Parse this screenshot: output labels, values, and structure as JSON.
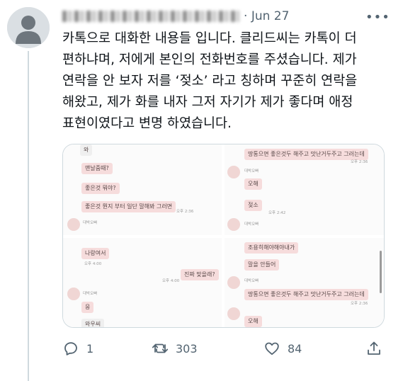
{
  "tweet": {
    "author_name": "",
    "time": "Jun 27",
    "more_label": "•••",
    "text": "카톡으로 대화한 내용들 입니다. 클리드씨는 카톡이 더\n편하냐며, 저에게 본인의 전화번호를 주셨습니다. 제가\n연락을 안 보자 저를 ‘젖소’ 라고 칭하며 꾸준히 연락을\n해왔고, 제가 화를 내자 그저 자기가 제가 좋다며 애정\n표현이였다고 변명 하였습니다."
  },
  "media": {
    "tiles": [
      {
        "messages": [
          {
            "text": "와"
          },
          {
            "text": "맨날줌때?"
          },
          {
            "text": "좋은것 뭐야?"
          },
          {
            "text": "좋은것 뭔지 부터 일단 말해봐 그러면"
          }
        ],
        "sender": "대박오빠",
        "time": "오후 2:36"
      },
      {
        "messages": [
          {
            "text": "땅통으면 좋은것두 해주고 맛난거두주고 그러는데"
          },
          {
            "text": "오해"
          },
          {
            "text": "젖소"
          }
        ],
        "sender": "대박오빠",
        "time_a": "오후 2:36",
        "time_b": "오후 2:42"
      },
      {
        "messages": [
          {
            "text": "나랑여서"
          },
          {
            "text": "진짜 맞을래?"
          },
          {
            "text": "응"
          },
          {
            "text": "와우씨"
          }
        ],
        "sender": "대박오빠",
        "time_a": "오후 4:00",
        "time_b": "오후 4:00"
      },
      {
        "messages": [
          {
            "text": "조용히해야해야내가"
          },
          {
            "text": "말을 안들어"
          },
          {
            "text": "땅통으면 좋은것두 해주고 맛난거두주고 그러는데"
          },
          {
            "text": "오해"
          }
        ],
        "sender": "대박오빠",
        "time": "오후 2:36"
      }
    ]
  },
  "actions": {
    "replies": "1",
    "retweets": "303",
    "likes": "84"
  },
  "icons": {
    "reply": "reply-icon",
    "retweet": "retweet-icon",
    "like": "heart-icon",
    "share": "share-icon",
    "more": "more-dots-icon"
  },
  "colors": {
    "text": "#0f1419",
    "secondary": "#536471",
    "border": "#cfd9de",
    "chat_bubble": "#f6dcdc"
  }
}
